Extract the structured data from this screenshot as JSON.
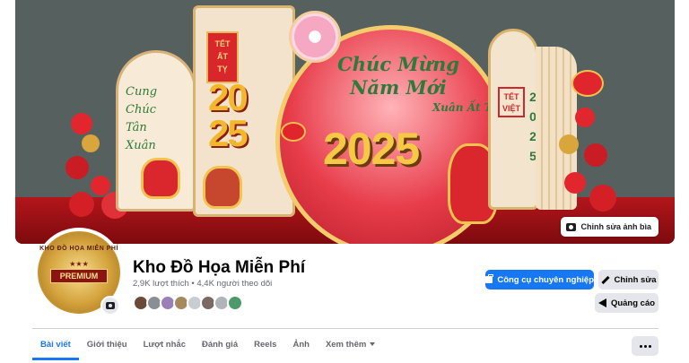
{
  "cover": {
    "left_panel_text": [
      "Cung",
      "Chúc",
      "Tân",
      "Xuân"
    ],
    "tall_panel_small_text": [
      "TẾT",
      "ẤT",
      "TỴ"
    ],
    "tall_panel_year": [
      "20",
      "25"
    ],
    "circle_script": [
      "Chúc Mừng",
      "Năm Mới"
    ],
    "circle_sub": "Xuân Ất Tỵ",
    "circle_year": "2025",
    "tet_box": [
      "TẾT",
      "VIỆT"
    ],
    "vertical_year": [
      "2",
      "0",
      "2",
      "5"
    ],
    "edit_cover_label": "Chỉnh sửa ảnh bìa"
  },
  "profile": {
    "avatar_arc_text": "KHO ĐỒ HỌA MIỄN PHÍ",
    "avatar_stars": "★★★",
    "avatar_badge": "PREMIUM",
    "page_name": "Kho Đồ Họa Miễn Phí",
    "likes": "2,9K lượt thích",
    "separator": " • ",
    "followers": "4,4K người theo dõi",
    "follower_colors": [
      "#6b4a3a",
      "#8a8f96",
      "#9b7fb8",
      "#a58a5e",
      "#c9ccd1",
      "#7a6a64",
      "#b0b3b8",
      "#4c9a6a"
    ]
  },
  "actions": {
    "professional_tools": "Công cụ chuyên nghiệp",
    "edit": "Chỉnh sửa",
    "ads": "Quảng cáo"
  },
  "tabs": [
    {
      "label": "Bài viết",
      "active": true
    },
    {
      "label": "Giới thiệu"
    },
    {
      "label": "Lượt nhắc"
    },
    {
      "label": "Đánh giá"
    },
    {
      "label": "Reels"
    },
    {
      "label": "Ảnh"
    },
    {
      "label": "Xem thêm"
    }
  ],
  "colors": {
    "accent": "#1877f2",
    "button_gray": "#e4e6eb",
    "text_primary": "#050505",
    "text_secondary": "#65676b"
  }
}
